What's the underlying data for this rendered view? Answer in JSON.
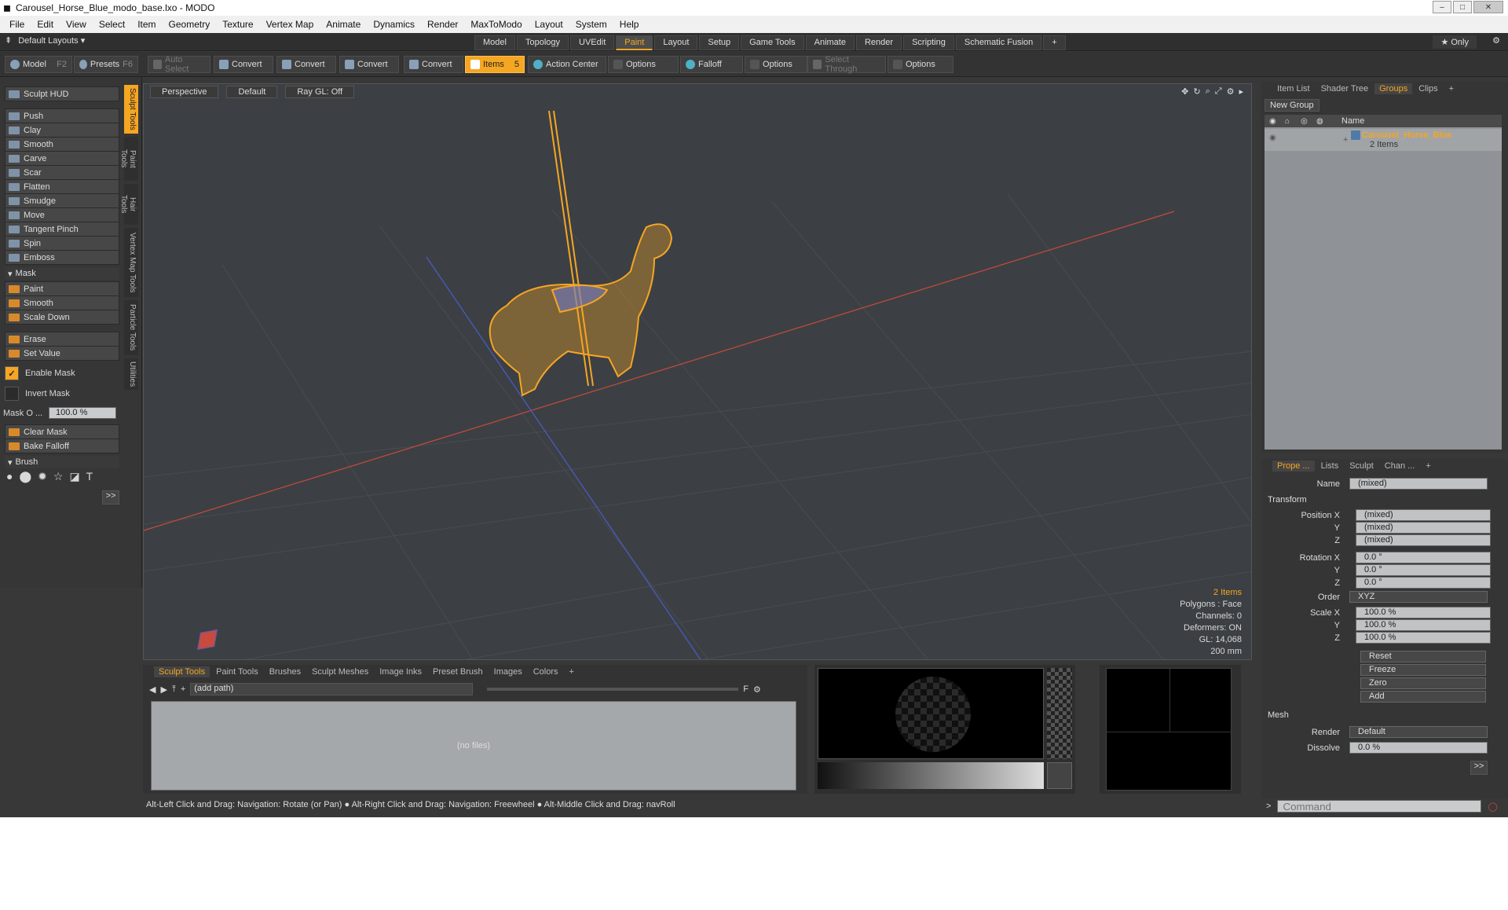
{
  "window": {
    "title": "Carousel_Horse_Blue_modo_base.lxo - MODO"
  },
  "menu": [
    "File",
    "Edit",
    "View",
    "Select",
    "Item",
    "Geometry",
    "Texture",
    "Vertex Map",
    "Animate",
    "Dynamics",
    "Render",
    "MaxToModo",
    "Layout",
    "System",
    "Help"
  ],
  "layout": {
    "selector": "Default Layouts ▾",
    "tabs": [
      "Model",
      "Topology",
      "UVEdit",
      "Paint",
      "Layout",
      "Setup",
      "Game Tools",
      "Animate",
      "Render",
      "Scripting",
      "Schematic Fusion"
    ],
    "active": "Paint",
    "plus": "+",
    "only": "★  Only"
  },
  "toolbar": {
    "model": "Model",
    "model_key": "F2",
    "presets": "Presets",
    "presets_key": "F6",
    "auto_select": "Auto Select",
    "convert": "Convert",
    "items": "Items",
    "items_key": "5",
    "action_center": "Action Center",
    "options": "Options",
    "falloff": "Falloff",
    "select_through": "Select Through"
  },
  "sculpt": {
    "hud": "Sculpt HUD",
    "tools": [
      "Push",
      "Clay",
      "Smooth",
      "Carve",
      "Scar",
      "Flatten",
      "Smudge",
      "Move",
      "Tangent Pinch",
      "Spin",
      "Emboss"
    ],
    "mask_header": "Mask",
    "mask_tools": [
      "Paint",
      "Smooth",
      "Scale Down"
    ],
    "erase": "Erase",
    "set_value": "Set Value",
    "enable_mask": "Enable Mask",
    "invert_mask": "Invert Mask",
    "mask_opacity_label": "Mask O ...",
    "mask_opacity_value": "100.0 %",
    "clear_mask": "Clear Mask",
    "bake_falloff": "Bake Falloff",
    "brush_header": "Brush",
    "more": ">>",
    "vtabs": [
      "Sculpt Tools",
      "Paint Tools",
      "Hair Tools",
      "Vertex Map Tools",
      "Particle Tools",
      "Utilities"
    ]
  },
  "viewport": {
    "view": "Perspective",
    "shading": "Default",
    "raygl": "Ray GL: Off",
    "info": {
      "items": "2 Items",
      "polygons": "Polygons : Face",
      "channels": "Channels: 0",
      "deformers": "Deformers: ON",
      "gl": "GL: 14,068",
      "scale": "200 mm"
    }
  },
  "bottom": {
    "tabs": [
      "Sculpt Tools",
      "Paint Tools",
      "Brushes",
      "Sculpt Meshes",
      "Image Inks",
      "Preset Brush",
      "Images",
      "Colors"
    ],
    "active": "Sculpt Tools",
    "plus": "+",
    "path": "(add path)",
    "nofiles": "(no files)",
    "f_label": "F"
  },
  "status": "Alt-Left Click and Drag: Navigation: Rotate (or Pan) ● Alt-Right Click and Drag: Navigation: Freewheel ● Alt-Middle Click and Drag: navRoll",
  "groups_panel": {
    "tabs": [
      "Item List",
      "Shader Tree",
      "Groups",
      "Clips"
    ],
    "active": "Groups",
    "plus": "+",
    "new_group": "New Group",
    "col_name": "Name",
    "group_name": "Carousel_Horse_Blue",
    "group_count": "2 Items"
  },
  "properties": {
    "tabs": [
      "Prope ...",
      "Lists",
      "Sculpt",
      "Chan ..."
    ],
    "active": "Prope ...",
    "plus": "+",
    "name_label": "Name",
    "name_value": "(mixed)",
    "transform": "Transform",
    "position_label": "Position X",
    "position": [
      "(mixed)",
      "(mixed)",
      "(mixed)"
    ],
    "rotation_label": "Rotation X",
    "rotation": [
      "0.0 °",
      "0.0 °",
      "0.0 °"
    ],
    "order_label": "Order",
    "order": "XYZ",
    "scale_label": "Scale X",
    "scale": [
      "100.0 %",
      "100.0 %",
      "100.0 %"
    ],
    "y": "Y",
    "z": "Z",
    "actions": [
      "Reset",
      "Freeze",
      "Zero",
      "Add"
    ],
    "mesh": "Mesh",
    "render_label": "Render",
    "render_value": "Default",
    "dissolve_label": "Dissolve",
    "dissolve_value": "0.0 %",
    "more": ">>"
  },
  "command": {
    "prompt": ">",
    "placeholder": "Command"
  },
  "colors": {
    "accent": "#f5a623",
    "bg": "#383838",
    "viewport": "#3c4044",
    "xaxis": "#c84a3c",
    "zaxis": "#4c5cc8",
    "wire": "#f5a623"
  }
}
